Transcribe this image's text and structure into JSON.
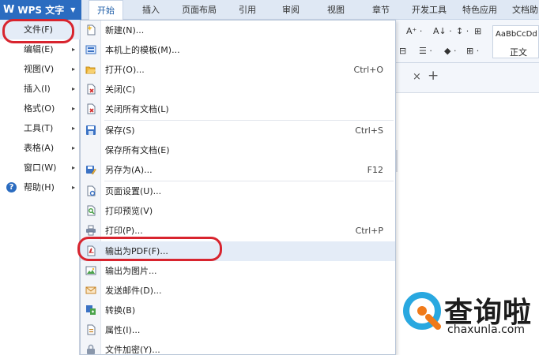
{
  "app": {
    "logo_glyph": "W",
    "title": "WPS 文字",
    "dropdown_glyph": "▼"
  },
  "tabs": [
    "开始",
    "插入",
    "页面布局",
    "引用",
    "审阅",
    "视图",
    "章节",
    "开发工具",
    "特色应用",
    "文档助"
  ],
  "ribbon": {
    "font_size_glyph": "A⁺ ·",
    "sort_glyph": "A↓ ·",
    "indent_glyph": "↕ ·",
    "table_glyph": "⊞",
    "grid_glyph": "⊟",
    "list_glyph": "☰ ·",
    "shade_glyph": "◆ ·",
    "border_glyph": "⊞ ·",
    "style_sample": "AaBbCcDd",
    "style_name": "正文"
  },
  "doctabs": {
    "close_glyph": "×",
    "add_glyph": "+"
  },
  "left_menu": [
    {
      "label": "文件(F)",
      "arrow": ""
    },
    {
      "label": "编辑(E)",
      "arrow": "▸"
    },
    {
      "label": "视图(V)",
      "arrow": "▸"
    },
    {
      "label": "插入(I)",
      "arrow": "▸"
    },
    {
      "label": "格式(O)",
      "arrow": "▸"
    },
    {
      "label": "工具(T)",
      "arrow": "▸"
    },
    {
      "label": "表格(A)",
      "arrow": "▸"
    },
    {
      "label": "窗口(W)",
      "arrow": "▸"
    },
    {
      "label": "帮助(H)",
      "arrow": "▸"
    }
  ],
  "help_icon_glyph": "?",
  "file_menu": [
    {
      "label": "新建(N)...",
      "shortcut": ""
    },
    {
      "label": "本机上的模板(M)...",
      "shortcut": ""
    },
    {
      "label": "打开(O)...",
      "shortcut": "Ctrl+O"
    },
    {
      "label": "关闭(C)",
      "shortcut": ""
    },
    {
      "label": "关闭所有文档(L)",
      "shortcut": ""
    },
    {
      "label": "保存(S)",
      "shortcut": "Ctrl+S"
    },
    {
      "label": "保存所有文档(E)",
      "shortcut": ""
    },
    {
      "label": "另存为(A)...",
      "shortcut": "F12"
    },
    {
      "label": "页面设置(U)...",
      "shortcut": ""
    },
    {
      "label": "打印预览(V)",
      "shortcut": ""
    },
    {
      "label": "打印(P)...",
      "shortcut": "Ctrl+P"
    },
    {
      "label": "输出为PDF(F)...",
      "shortcut": ""
    },
    {
      "label": "输出为图片...",
      "shortcut": ""
    },
    {
      "label": "发送邮件(D)...",
      "shortcut": ""
    },
    {
      "label": "转换(B)",
      "shortcut": ""
    },
    {
      "label": "属性(I)...",
      "shortcut": ""
    },
    {
      "label": "文件加密(Y)...",
      "shortcut": ""
    }
  ],
  "watermark": {
    "text": "查询啦",
    "url": "chaxunla.com"
  },
  "colors": {
    "accent": "#2b6cc0",
    "annotation": "#d8242e",
    "highlight": "#e4ecf7"
  }
}
